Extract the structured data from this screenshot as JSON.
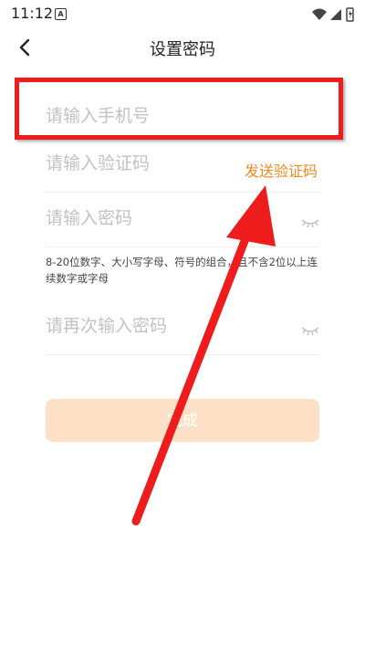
{
  "status_bar": {
    "time": "11:12",
    "badge": "A"
  },
  "header": {
    "title": "设置密码",
    "back_icon": "chevron-left-icon"
  },
  "form": {
    "phone_placeholder": "请输入手机号",
    "code_placeholder": "请输入验证码",
    "send_code_label": "发送验证码",
    "password_placeholder": "请输入密码",
    "password_hint": "8-20位数字、大小写字母、符号的组合，且不含2位以上连续数字或字母",
    "confirm_placeholder": "请再次输入密码",
    "submit_label": "完成"
  },
  "colors": {
    "accent": "#f08a1c",
    "button_bg": "#fde0c6",
    "annotation": "#ee1c1c"
  }
}
